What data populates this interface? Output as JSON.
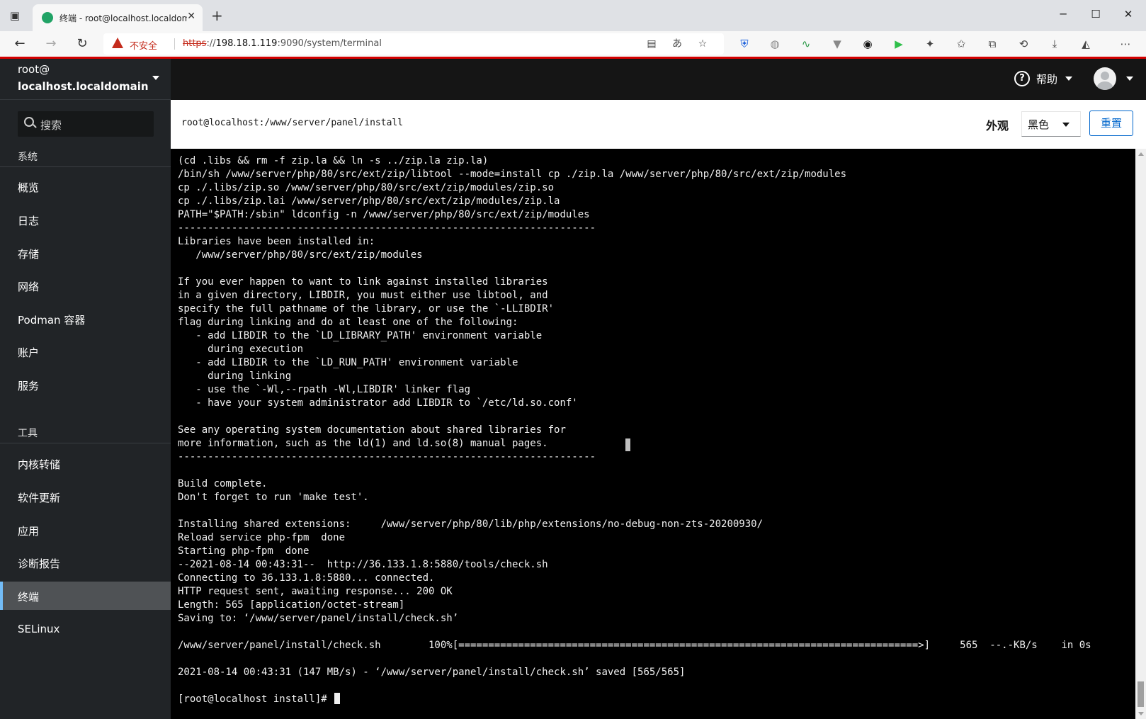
{
  "browser": {
    "tab_title": "终端 - root@localhost.localdomain",
    "address": {
      "security_warning": "不安全",
      "url_scheme": "https",
      "url_host": "198.18.1.119",
      "url_rest": ":9090/system/terminal"
    }
  },
  "sidebar": {
    "host_user": "root@",
    "host_name": "localhost.localdomain",
    "search_placeholder": "搜索",
    "sections": [
      {
        "title": "系统",
        "items": [
          "概览",
          "日志",
          "存储",
          "网络",
          "Podman 容器",
          "账户",
          "服务"
        ]
      },
      {
        "title": "工具",
        "items": [
          "内核转储",
          "软件更新",
          "应用",
          "诊断报告",
          "终端",
          "SELinux"
        ]
      }
    ],
    "active_item": "终端"
  },
  "masthead": {
    "help_label": "帮助"
  },
  "terminal_toolbar": {
    "path": "root@localhost:/www/server/panel/install",
    "appearance_label": "外观",
    "theme_value": "黑色",
    "reset_label": "重置"
  },
  "terminal": {
    "lines": [
      "(cd .libs && rm -f zip.la && ln -s ../zip.la zip.la)",
      "/bin/sh /www/server/php/80/src/ext/zip/libtool --mode=install cp ./zip.la /www/server/php/80/src/ext/zip/modules",
      "cp ./.libs/zip.so /www/server/php/80/src/ext/zip/modules/zip.so",
      "cp ./.libs/zip.lai /www/server/php/80/src/ext/zip/modules/zip.la",
      "PATH=\"$PATH:/sbin\" ldconfig -n /www/server/php/80/src/ext/zip/modules",
      "----------------------------------------------------------------------",
      "Libraries have been installed in:",
      "   /www/server/php/80/src/ext/zip/modules",
      "",
      "If you ever happen to want to link against installed libraries",
      "in a given directory, LIBDIR, you must either use libtool, and",
      "specify the full pathname of the library, or use the `-LLIBDIR'",
      "flag during linking and do at least one of the following:",
      "   - add LIBDIR to the `LD_LIBRARY_PATH' environment variable",
      "     during execution",
      "   - add LIBDIR to the `LD_RUN_PATH' environment variable",
      "     during linking",
      "   - use the `-Wl,--rpath -Wl,LIBDIR' linker flag",
      "   - have your system administrator add LIBDIR to `/etc/ld.so.conf'",
      "",
      "See any operating system documentation about shared libraries for",
      "more information, such as the ld(1) and ld.so(8) manual pages.",
      "----------------------------------------------------------------------",
      "",
      "Build complete.",
      "Don't forget to run 'make test'.",
      "",
      "Installing shared extensions:     /www/server/php/80/lib/php/extensions/no-debug-non-zts-20200930/",
      "Reload service php-fpm  done",
      "Starting php-fpm  done",
      "--2021-08-14 00:43:31--  http://36.133.1.8:5880/tools/check.sh",
      "Connecting to 36.133.1.8:5880... connected.",
      "HTTP request sent, awaiting response... 200 OK",
      "Length: 565 [application/octet-stream]",
      "Saving to: ‘/www/server/panel/install/check.sh’",
      "",
      "/www/server/panel/install/check.sh        100%[=============================================================================>]     565  --.-KB/s    in 0s",
      "",
      "2021-08-14 00:43:31 (147 MB/s) - ‘/www/server/panel/install/check.sh’ saved [565/565]",
      ""
    ],
    "prompt": "[root@localhost install]# "
  }
}
